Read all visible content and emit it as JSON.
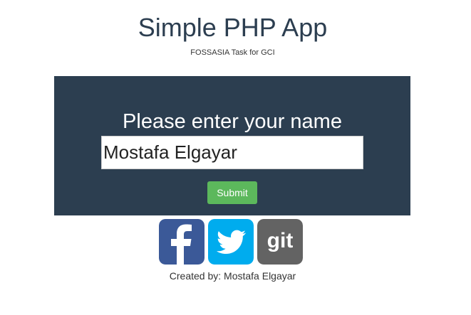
{
  "header": {
    "title": "Simple PHP App",
    "subtitle": "FOSSASIA Task for GCI"
  },
  "form": {
    "prompt": "Please enter your name",
    "name_value": "Mostafa Elgayar",
    "submit_label": "Submit"
  },
  "social": {
    "links": [
      {
        "icon": "facebook-icon",
        "color": "#3b5998"
      },
      {
        "icon": "twitter-icon",
        "color": "#00acee"
      },
      {
        "icon": "git-icon",
        "color": "#636363",
        "text": "git"
      }
    ]
  },
  "footer": {
    "credit": "Created by: Mostafa Elgayar"
  },
  "colors": {
    "panel": "#2c3e50",
    "submit": "#5cb85c"
  }
}
